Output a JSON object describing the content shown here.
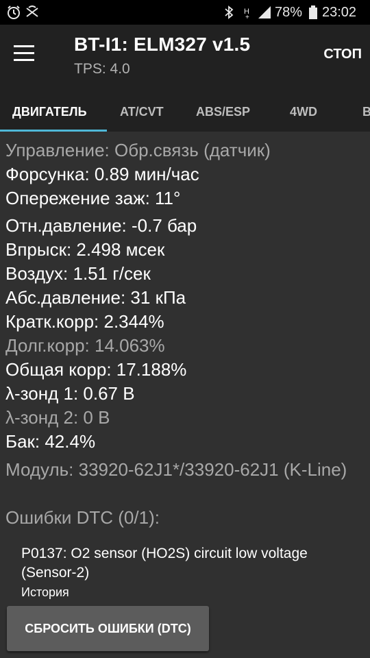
{
  "status_bar": {
    "battery_percent": "78%",
    "time": "23:02",
    "icons": [
      "alarm-icon",
      "silent-mode-icon",
      "bluetooth-icon",
      "h-plus-icon",
      "signal-icon",
      "battery-icon"
    ]
  },
  "app_bar": {
    "title": "BT-I1: ELM327 v1.5",
    "subtitle": "TPS: 4.0",
    "stop_label": "СТОП"
  },
  "tabs": [
    {
      "label": "ДВИГАТЕЛЬ",
      "active": true
    },
    {
      "label": "AT/CVT",
      "active": false
    },
    {
      "label": "ABS/ESP",
      "active": false
    },
    {
      "label": "4WD",
      "active": false
    },
    {
      "label": "В",
      "active": false
    }
  ],
  "params": [
    {
      "text": "Управление: Обр.связь (датчик)",
      "dim": true
    },
    {
      "text": "Форсунка: 0.89 мин/час",
      "dim": false
    },
    {
      "text": "Опережение заж: 11°",
      "dim": false
    },
    {
      "text": "Отн.давление: -0.7 бар",
      "dim": false
    },
    {
      "text": "Впрыск: 2.498 мсек",
      "dim": false
    },
    {
      "text": "Воздух: 1.51 г/сек",
      "dim": false
    },
    {
      "text": "Абс.давление: 31 кПа",
      "dim": false
    },
    {
      "text": "Кратк.корр: 2.344%",
      "dim": false
    },
    {
      "text": "Долг.корр: 14.063%",
      "dim": true
    },
    {
      "text": "Общая корр: 17.188%",
      "dim": false
    },
    {
      "text": "λ-зонд 1: 0.67 В",
      "dim": false
    },
    {
      "text": "λ-зонд 2: 0 В",
      "dim": true
    },
    {
      "text": "Бак: 42.4%",
      "dim": false
    }
  ],
  "module": "Модуль: 33920-62J1*/33920-62J1 (K-Line)",
  "dtc_header": "Ошибки DTC (0/1):",
  "dtc": {
    "code_text": "P0137: O2 sensor (HO2S) circuit low voltage (Sensor-2)",
    "state": "История"
  },
  "reset_button_label": "СБРОСИТЬ ОШИБКИ (DTC)",
  "colors": {
    "background": "#303030",
    "appbar": "#212121",
    "tab_indicator": "#4fb8d8",
    "dim_text": "#a8a8a8",
    "button": "#5c5c5c"
  }
}
